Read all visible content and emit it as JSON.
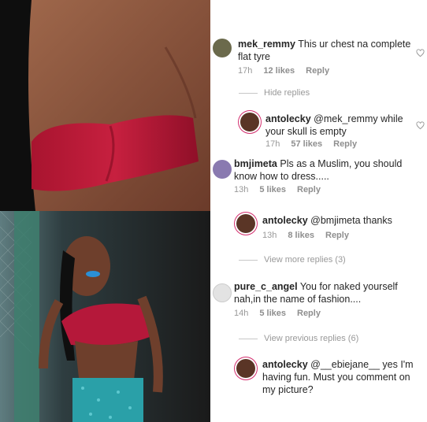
{
  "comments": [
    {
      "user": "mek_remmy",
      "text": "This ur chest na complete flat tyre",
      "time": "17h",
      "likes": "12 likes",
      "reply": "Reply"
    },
    {
      "user": "antolecky",
      "text": "@mek_remmy while your skull is empty",
      "time": "17h",
      "likes": "57 likes",
      "reply": "Reply"
    },
    {
      "user": "bmjimeta",
      "text": "Pls as a Muslim, you should know how to dress.....",
      "time": "13h",
      "likes": "5 likes",
      "reply": "Reply"
    },
    {
      "user": "antolecky",
      "text": "@bmjimeta thanks",
      "time": "13h",
      "likes": "8 likes",
      "reply": "Reply"
    },
    {
      "user": "pure_c_angel",
      "text": "You for naked yourself nah,in the name of fashion....",
      "time": "14h",
      "likes": "5 likes",
      "reply": "Reply"
    },
    {
      "user": "antolecky",
      "text": "@__ebiejane__ yes I'm having fun. Must you comment on my picture?",
      "time": "",
      "likes": "",
      "reply": ""
    }
  ],
  "toggles": {
    "hide_replies": "Hide replies",
    "view_more": "View more replies (3)",
    "view_previous": "View previous replies (6)"
  },
  "colors": {
    "top_fabric": "#b5183a",
    "skin": "#7a4a35",
    "hair": "#141414",
    "skirt": "#2aa0a8"
  },
  "icons": [
    "heart-icon",
    "avatar"
  ]
}
